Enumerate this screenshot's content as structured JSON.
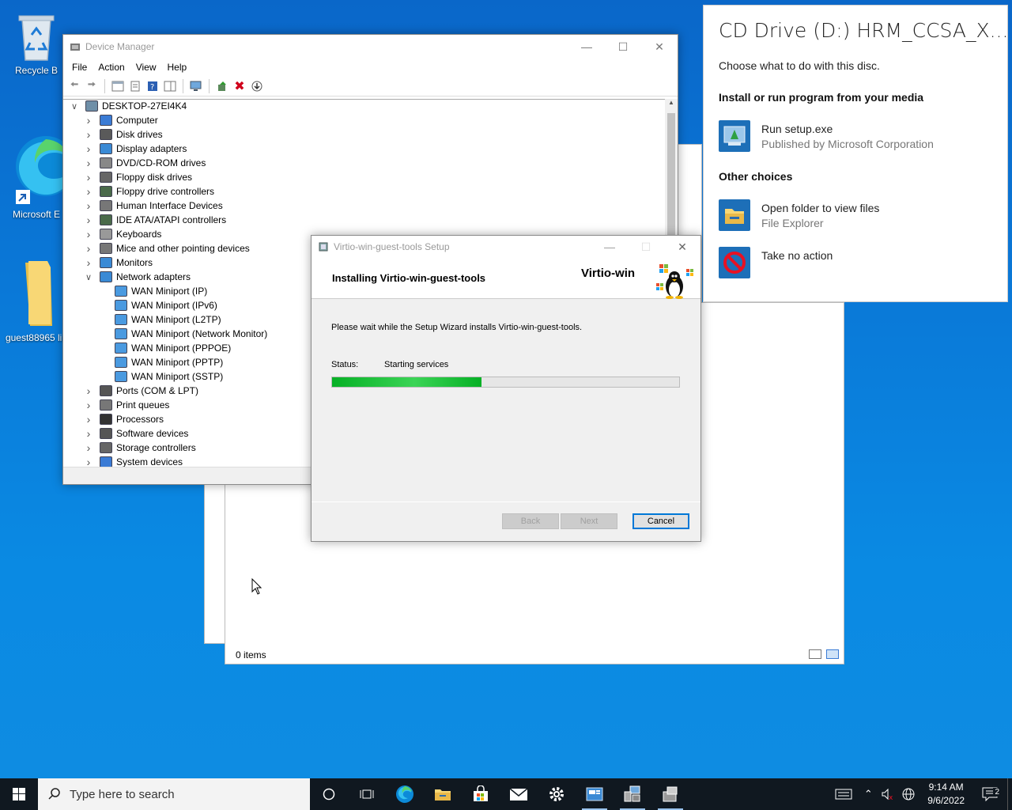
{
  "desktop": {
    "icons": [
      {
        "label": "Recycle B"
      },
      {
        "label": "Microsoft E"
      },
      {
        "label": "guest88965 lin"
      }
    ]
  },
  "device_manager": {
    "title": "Device Manager",
    "menu": [
      "File",
      "Action",
      "View",
      "Help"
    ],
    "root": "DESKTOP-27EI4K4",
    "categories": [
      {
        "label": "Computer",
        "icon": "computer-icon",
        "color": "#3a7bd5"
      },
      {
        "label": "Disk drives",
        "icon": "disk-icon",
        "color": "#5a5a5a"
      },
      {
        "label": "Display adapters",
        "icon": "display-icon",
        "color": "#3a8ad5"
      },
      {
        "label": "DVD/CD-ROM drives",
        "icon": "dvd-icon",
        "color": "#888888"
      },
      {
        "label": "Floppy disk drives",
        "icon": "floppy-icon",
        "color": "#666666"
      },
      {
        "label": "Floppy drive controllers",
        "icon": "controller-icon",
        "color": "#4a6a4a"
      },
      {
        "label": "Human Interface Devices",
        "icon": "hid-icon",
        "color": "#777777"
      },
      {
        "label": "IDE ATA/ATAPI controllers",
        "icon": "ide-icon",
        "color": "#4a6a4a"
      },
      {
        "label": "Keyboards",
        "icon": "keyboard-icon",
        "color": "#999999"
      },
      {
        "label": "Mice and other pointing devices",
        "icon": "mouse-icon",
        "color": "#777777"
      },
      {
        "label": "Monitors",
        "icon": "monitor-icon",
        "color": "#3a8ad5"
      },
      {
        "label": "Network adapters",
        "icon": "network-icon",
        "color": "#3a8ad5",
        "expanded": true
      }
    ],
    "network_children": [
      "WAN Miniport (IP)",
      "WAN Miniport (IPv6)",
      "WAN Miniport (L2TP)",
      "WAN Miniport (Network Monitor)",
      "WAN Miniport (PPPOE)",
      "WAN Miniport (PPTP)",
      "WAN Miniport (SSTP)"
    ],
    "categories_after": [
      {
        "label": "Ports (COM & LPT)",
        "icon": "port-icon",
        "color": "#555555"
      },
      {
        "label": "Print queues",
        "icon": "printer-icon",
        "color": "#777777"
      },
      {
        "label": "Processors",
        "icon": "cpu-icon",
        "color": "#333333"
      },
      {
        "label": "Software devices",
        "icon": "software-icon",
        "color": "#555555"
      },
      {
        "label": "Storage controllers",
        "icon": "storage-icon",
        "color": "#666666"
      },
      {
        "label": "System devices",
        "icon": "system-icon",
        "color": "#3a7bd5"
      }
    ]
  },
  "explorer": {
    "status": "0 items"
  },
  "setup": {
    "title": "Virtio-win-guest-tools Setup",
    "heading": "Installing Virtio-win-guest-tools",
    "brand": "Virtio-win",
    "message": "Please wait while the Setup Wizard installs Virtio-win-guest-tools.",
    "status_label": "Status:",
    "status_value": "Starting services",
    "progress": 0.43,
    "buttons": {
      "back": "Back",
      "next": "Next",
      "cancel": "Cancel"
    }
  },
  "autoplay": {
    "title": "CD Drive (D:) HRM_CCSA_X...",
    "subtitle": "Choose what to do with this disc.",
    "section1": "Install or run program from your media",
    "option_run": {
      "title": "Run setup.exe",
      "sub": "Published by Microsoft Corporation"
    },
    "section2": "Other choices",
    "option_open": {
      "title": "Open folder to view files",
      "sub": "File Explorer"
    },
    "option_none": {
      "title": "Take no action"
    }
  },
  "taskbar": {
    "search_placeholder": "Type here to search",
    "time": "9:14 AM",
    "date": "9/6/2022",
    "notification_count": "2"
  }
}
